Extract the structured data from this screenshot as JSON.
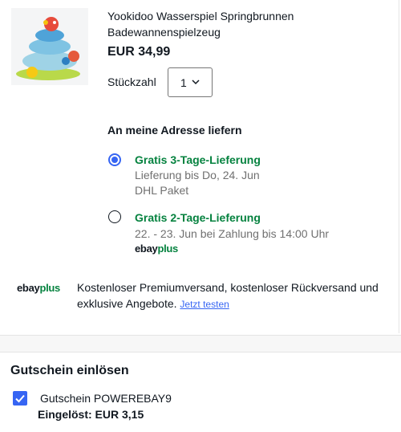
{
  "product": {
    "title": "Yookidoo Wasserspiel Springbrunnen Badewannenspielzeug",
    "price": "EUR 34,99",
    "quantity_label": "Stückzahl",
    "quantity_value": "1"
  },
  "shipping": {
    "heading": "An meine Adresse liefern",
    "options": [
      {
        "title": "Gratis 3-Tage-Lieferung",
        "line1": "Lieferung bis Do, 24. Jun",
        "line2": "DHL Paket",
        "selected": true
      },
      {
        "title": "Gratis 2-Tage-Lieferung",
        "line1": "22. - 23. Jun bei Zahlung bis 14:00 Uhr",
        "badge": "ebayplus",
        "selected": false
      }
    ]
  },
  "ebay_plus_logo": {
    "ebay": "ebay",
    "plus": "plus"
  },
  "promo": {
    "text": "Kostenloser Premiumversand, kostenloser Rückversand und exklusive Angebote.",
    "link": "Jetzt testen"
  },
  "coupon": {
    "heading": "Gutschein einlösen",
    "label": "Gutschein POWEREBAY9",
    "applied": "Eingelöst: EUR 3,15",
    "checked": true
  },
  "colors": {
    "accent_blue": "#3665f3",
    "success_green": "#05823f",
    "muted_text": "#707070"
  }
}
